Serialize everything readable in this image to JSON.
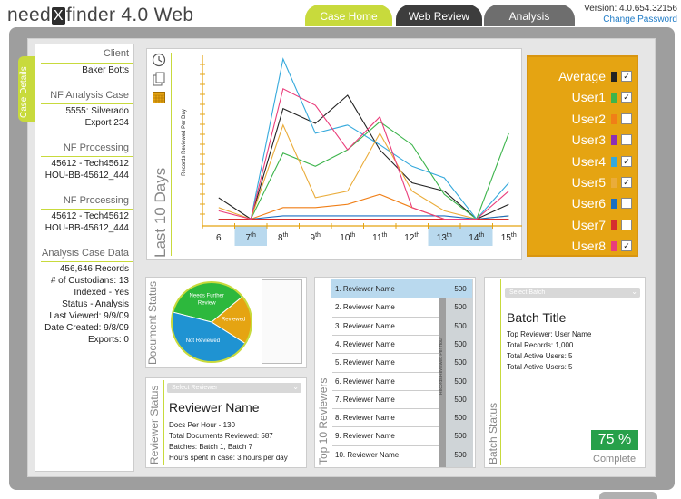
{
  "app": {
    "logo_pre": "need",
    "logo_mark": "X",
    "logo_post": "finder 4.0 Web",
    "version": "Version: 4.0.654.32156",
    "change_password": "Change Password"
  },
  "tabs": [
    "Case Home",
    "Web Review",
    "Analysis"
  ],
  "side_tab": "Case Details",
  "case": {
    "client_label": "Client",
    "client": "Baker Botts",
    "nf_analysis_label": "NF Analysis Case",
    "nf_analysis_1": "5555: Silverado",
    "nf_analysis_2": "Export 234",
    "nf_processing_label_1": "NF Processing",
    "nf_processing_1a": "45612 - Tech45612",
    "nf_processing_1b": "HOU-BB-45612_444",
    "nf_processing_label_2": "NF Processing",
    "nf_processing_2a": "45612 - Tech45612",
    "nf_processing_2b": "HOU-BB-45612_444",
    "analysis_label": "Analysis Case Data",
    "records": "456,646 Records",
    "custodians": "# of Custodians: 13",
    "indexed": "Indexed - Yes",
    "status": "Status - Analysis",
    "last_viewed": "Last Viewed: 9/9/09",
    "date_created": "Date Created: 9/8/09",
    "exports": "Exports: 0"
  },
  "graph": {
    "period_title": "Last 10 Days"
  },
  "chart_data": {
    "type": "line",
    "ylabel": "Records Reviewed Per Day",
    "x": [
      "6",
      "7th",
      "8th",
      "9th",
      "10th",
      "11th",
      "12th",
      "13th",
      "14th",
      "15th"
    ],
    "highlighted_days": [
      "7th",
      "13th",
      "14th"
    ],
    "series": [
      {
        "name": "Average",
        "color": "#222222",
        "values": [
          16,
          3,
          70,
          61,
          78,
          45,
          25,
          20,
          3,
          12
        ]
      },
      {
        "name": "User1",
        "color": "#3cb44b",
        "values": [
          3,
          3,
          43,
          35,
          45,
          62,
          48,
          18,
          3,
          55
        ]
      },
      {
        "name": "User2",
        "color": "#f07f17",
        "values": [
          3,
          3,
          10,
          10,
          12,
          18,
          10,
          3,
          3,
          3
        ]
      },
      {
        "name": "User3",
        "color": "#8d2fb5",
        "values": [
          3,
          3,
          3,
          3,
          3,
          3,
          3,
          3,
          3,
          3
        ]
      },
      {
        "name": "User4",
        "color": "#35a9dc",
        "values": [
          3,
          3,
          100,
          55,
          60,
          48,
          35,
          28,
          3,
          25
        ]
      },
      {
        "name": "User5",
        "color": "#eaac3a",
        "values": [
          10,
          3,
          60,
          16,
          20,
          55,
          20,
          8,
          3,
          5
        ]
      },
      {
        "name": "User6",
        "color": "#1b6fc3",
        "values": [
          3,
          3,
          5,
          5,
          5,
          5,
          5,
          5,
          3,
          5
        ]
      },
      {
        "name": "User7",
        "color": "#d52f2f",
        "values": [
          3,
          3,
          3,
          3,
          3,
          3,
          3,
          3,
          3,
          3
        ]
      },
      {
        "name": "User8",
        "color": "#ea3d7b",
        "values": [
          8,
          3,
          82,
          72,
          45,
          65,
          10,
          3,
          3,
          20
        ]
      }
    ],
    "legend_checked": [
      true,
      true,
      false,
      false,
      true,
      true,
      false,
      false,
      true
    ]
  },
  "document_status": {
    "title": "Document Status",
    "slices": [
      {
        "label": "Needs Further Review",
        "value": 35,
        "color": "#2db83d"
      },
      {
        "label": "Reviewed",
        "value": 20,
        "color": "#e5a412"
      },
      {
        "label": "Not Reviewed",
        "value": 45,
        "color": "#1f93d2"
      }
    ]
  },
  "reviewer_status": {
    "title": "Reviewer Status",
    "select_placeholder": "Select Reviewer",
    "name": "Reviewer Name",
    "docs_per_hour": "Docs Per Hour - 130",
    "total_docs": "Total Documents Reviewed: 587",
    "batches": "Batches: Batch 1, Batch 7",
    "hours": "Hours spent in case: 3 hours per day"
  },
  "top10": {
    "title": "Top 10 Reviewers",
    "column_label": "Records Reviewed Per Hour",
    "rows": [
      {
        "name": "1. Reviewer Name",
        "value": "500"
      },
      {
        "name": "2. Reviewer Name",
        "value": "500"
      },
      {
        "name": "3. Reviewer Name",
        "value": "500"
      },
      {
        "name": "4. Reviewer Name",
        "value": "500"
      },
      {
        "name": "5. Reviewer Name",
        "value": "500"
      },
      {
        "name": "6. Reviewer Name",
        "value": "500"
      },
      {
        "name": "7. Reviewer Name",
        "value": "500"
      },
      {
        "name": "8. Reviewer Name",
        "value": "500"
      },
      {
        "name": "9. Reviewer Name",
        "value": "500"
      },
      {
        "name": "10. Reviewer Name",
        "value": "500"
      }
    ]
  },
  "batch_status": {
    "title": "Batch Status",
    "select_placeholder": "Select Batch",
    "batch_title": "Batch Title",
    "top_reviewer": "Top Reviewer: User Name",
    "total_records": "Total Records: 1,000",
    "active_users_1": "Total Active Users: 5",
    "active_users_2": "Total Active Users: 5",
    "percent": "75 %",
    "percent_value": 75,
    "complete_label": "Complete"
  },
  "colors": {
    "accent": "#c8da3c",
    "legend_bg": "#e5a412",
    "highlight_day": "#b9d9ee",
    "progress": "#27a04a"
  }
}
